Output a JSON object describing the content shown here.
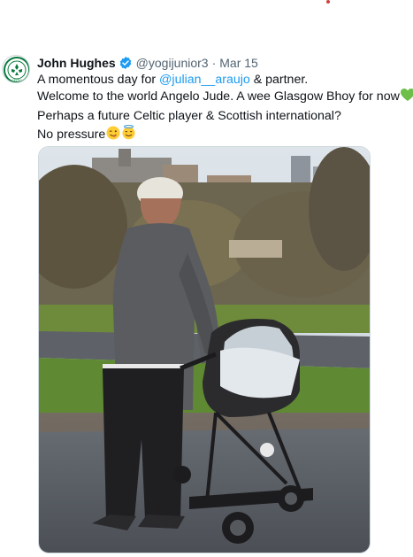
{
  "tweet": {
    "author_name": "John Hughes",
    "handle": "@yogijunior3",
    "separator": "·",
    "date": "Mar 15",
    "line1_before": "A momentous day for ",
    "line1_mention": "@julian__araujo",
    "line1_after": " & partner.",
    "line2": "Welcome to the world Angelo Jude. A wee Glasgow Bhoy for now",
    "line3": "Perhaps a future Celtic player & Scottish international?",
    "line4": "No pressure",
    "emojis": [
      "green-heart-icon",
      "winking-face-icon",
      "smiling-face-with-halo-icon"
    ]
  },
  "avatar": {
    "badge_text": "CELTIC"
  },
  "colors": {
    "link": "#1d9bf0",
    "verified": "#1d9bf0",
    "secondary_text": "#536471",
    "primary_text": "#0f1419",
    "accent_dot": "#d0413b"
  }
}
